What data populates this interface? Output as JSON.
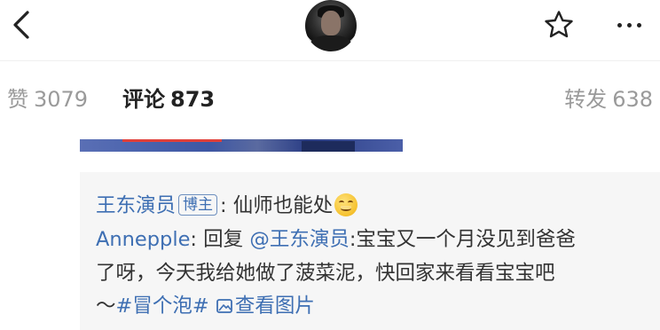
{
  "header": {
    "back_icon": "chevron-left-icon",
    "star_icon": "star-outline-icon",
    "more_icon": "more-horizontal-icon"
  },
  "tabs": {
    "likes": {
      "label": "赞",
      "count": "3079"
    },
    "comments": {
      "label": "评论",
      "count": "873"
    },
    "reposts": {
      "label": "转发",
      "count": "638"
    }
  },
  "comment": {
    "author": "王东演员",
    "badge": "博主",
    "separator": ": ",
    "text": "仙师也能处",
    "emoji": "smirk-emoji",
    "reply": {
      "user": "Annepple",
      "colon": ": ",
      "reply_word": "回复",
      "mention": "@王东演员",
      "line2_text": ":宝宝又一个月没见到爸爸",
      "line3_text": "了呀，今天我给她做了菠菜泥，快回家来看看宝宝吧",
      "line4_prefix": "～",
      "hashtag": "#冒个泡#",
      "view_image": "查看图片"
    }
  },
  "colors": {
    "link": "#3e6fb3",
    "text": "#333333",
    "muted": "#9a9a9a",
    "card_bg": "#f6f6f6"
  }
}
